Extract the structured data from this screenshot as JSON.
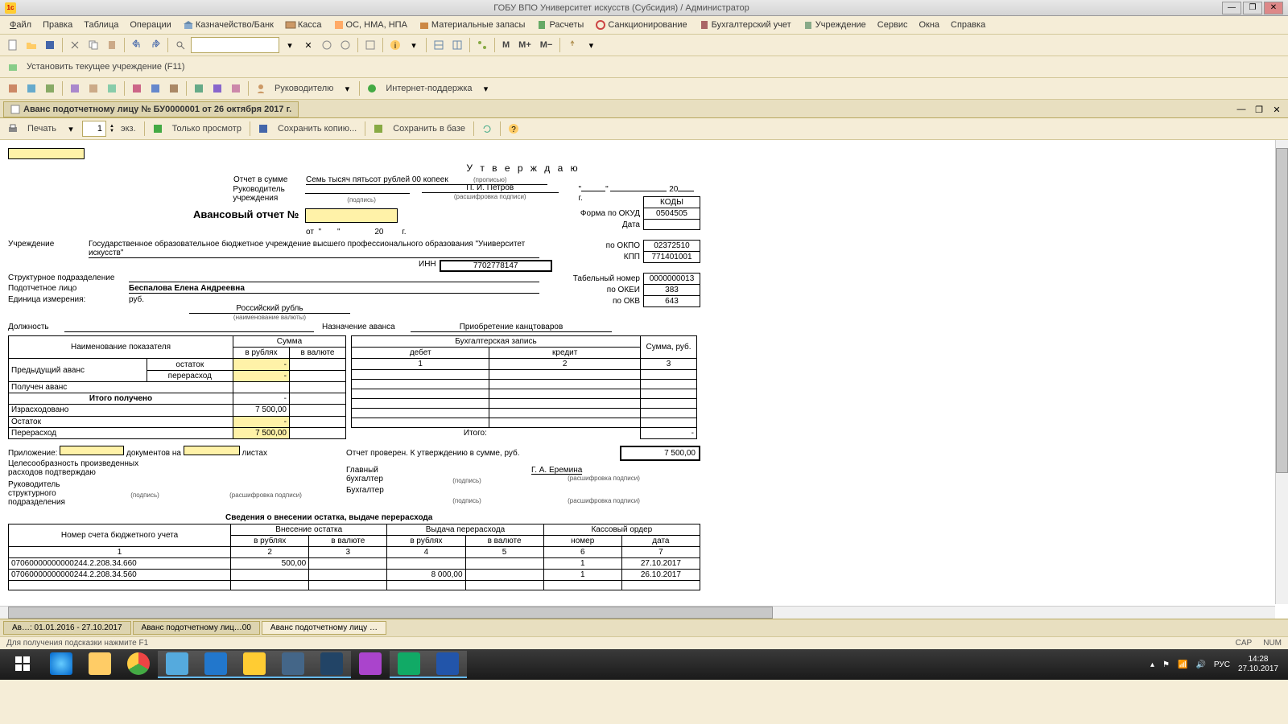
{
  "window": {
    "title": "ГОБУ ВПО Университет искусств (Субсидия) / Администратор"
  },
  "menu": {
    "file": "Файл",
    "edit": "Правка",
    "table": "Таблица",
    "ops": "Операции",
    "treasury": "Казначейство/Банк",
    "cash": "Касса",
    "os": "ОС, НМА, НПА",
    "mat": "Материальные запасы",
    "calc": "Расчеты",
    "sanc": "Санкционирование",
    "acct": "Бухгалтерский учет",
    "inst": "Учреждение",
    "service": "Сервис",
    "windows": "Окна",
    "help": "Справка"
  },
  "toolbar2": {
    "set_inst": "Установить текущее учреждение (F11)"
  },
  "toolbar3": {
    "leader": "Руководителю",
    "support": "Интернет-поддержка"
  },
  "doc_tab": {
    "title": "Аванс подотчетному лицу № БУ0000001 от 26 октября 2017 г."
  },
  "doc_toolbar": {
    "print": "Печать",
    "copies": "1",
    "ext": "экз.",
    "preview": "Только просмотр",
    "save_copy": "Сохранить копию...",
    "save_base": "Сохранить в базе"
  },
  "report": {
    "approve": "У т в е р ж д а ю",
    "sum_label": "Отчет в сумме",
    "sum_words": "Семь тысяч пятьсот рублей 00 копеек",
    "head_label": "Руководитель\nучреждения",
    "head_name": "П. И. Петров",
    "sig": "(подпись)",
    "propis": "(прописью)",
    "decode": "(расшифровка подписи)",
    "title": "Авансовый отчет №",
    "from": "от",
    "year": "20",
    "y": "г.",
    "org_label": "Учреждение",
    "org": "Государственное образовательное бюджетное учреждение высшего профессионального образования \"Университет искусств\"",
    "inn_label": "ИНН",
    "inn": "7702778147",
    "struct_label": "Структурное подразделение",
    "person_label": "Подотчетное лицо",
    "person": "Беспалова Елена Андреевна",
    "unit_label": "Единица измерения:",
    "unit": "руб.",
    "currency": "Российский рубль",
    "currency_note": "(наименование валюты)",
    "position_label": "Должность",
    "purpose_label": "Назначение аванса",
    "purpose": "Приобретение канцтоваров",
    "codes": {
      "header": "КОДЫ",
      "okud_l": "Форма по ОКУД",
      "okud": "0504505",
      "date_l": "Дата",
      "okpo_l": "по ОКПО",
      "okpo": "02372510",
      "kpp_l": "КПП",
      "kpp": "771401001",
      "tab_l": "Табельный номер",
      "tab": "0000000013",
      "okei_l": "по ОКЕИ",
      "okei": "383",
      "okv_l": "по ОКВ",
      "okv": "643"
    },
    "t1": {
      "h_name": "Наименование показателя",
      "h_sum": "Сумма",
      "h_rub": "в рублях",
      "h_val": "в валюте",
      "r1": "Предыдущий аванс",
      "r1a": "остаток",
      "r1b": "перерасход",
      "r2": "Получен аванс",
      "r3": "Итого получено",
      "r4": "Израсходовано",
      "r4v": "7 500,00",
      "r5": "Остаток",
      "r6": "Перерасход",
      "r6v": "7 500,00"
    },
    "t2": {
      "h": "Бухгалтерская запись",
      "h_d": "дебет",
      "h_c": "кредит",
      "h_s": "Сумма, руб.",
      "total": "Итого:"
    },
    "att": {
      "l1": "Приложение:",
      "l2": "документов на",
      "l3": "листах",
      "l4": "Целесообразность произведенных\nрасходов подтверждаю",
      "l5": "Руководитель\nструктурного\nподразделения"
    },
    "check": {
      "l": "Отчет проверен. К утверждению в сумме, руб.",
      "v": "7 500,00",
      "gb": "Главный\nбухгалтер",
      "gb_name": "Г. А. Еремина",
      "b": "Бухгалтер"
    },
    "t3": {
      "title": "Сведения о внесении остатка, выдаче перерасхода",
      "h1": "Номер счета бюджетного учета",
      "h2": "Внесение остатка",
      "h3": "Выдача перерасхода",
      "h4": "Кассовый ордер",
      "h_rub": "в рублях",
      "h_val": "в валюте",
      "h_num": "номер",
      "h_date": "дата",
      "rows": [
        {
          "acc": "07060000000000244.2.208.34.660",
          "in_rub": "500,00",
          "out_rub": "",
          "num": "1",
          "date": "27.10.2017"
        },
        {
          "acc": "07060000000000244.2.208.34.560",
          "in_rub": "",
          "out_rub": "8 000,00",
          "num": "1",
          "date": "26.10.2017"
        }
      ]
    }
  },
  "bottom_tabs": {
    "t1": "Ав…: 01.01.2016 - 27.10.2017",
    "t2": "Аванс подотчетному лиц…00",
    "t3": "Аванс подотчетному лицу …"
  },
  "status": {
    "hint": "Для получения подсказки нажмите F1",
    "cap": "CAP",
    "num": "NUM"
  },
  "tray": {
    "lang": "РУС",
    "time": "14:28",
    "date": "27.10.2017"
  }
}
